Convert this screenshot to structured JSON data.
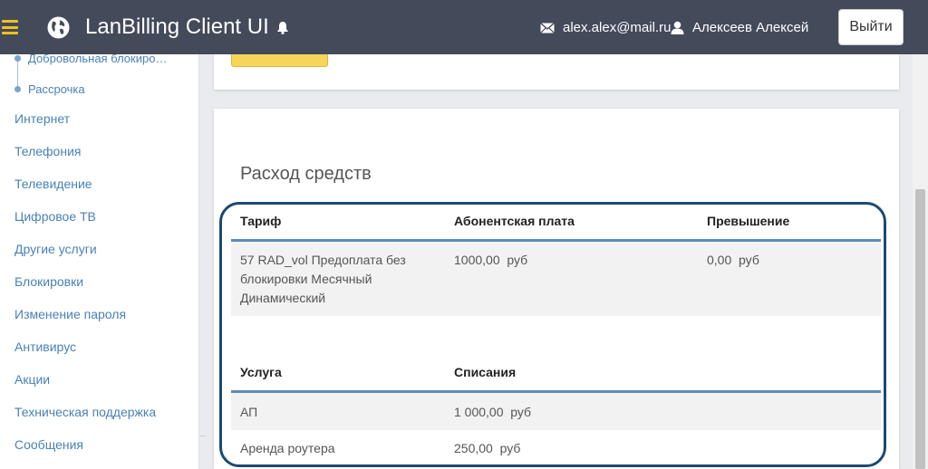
{
  "header": {
    "title": "LanBilling Client UI",
    "email": "alex.alex@mail.ru",
    "username": "Алексеев Алексей",
    "logout_label": "Выйти",
    "icons": [
      "menu-icon",
      "globe-icon",
      "bell-icon",
      "mail-icon",
      "user-icon"
    ]
  },
  "sidebar": {
    "sub_items": [
      "Добровольная блокиро…",
      "Рассрочка"
    ],
    "items": [
      "Интернет",
      "Телефония",
      "Телевидение",
      "Цифровое ТВ",
      "Другие услуги",
      "Блокировки",
      "Изменение пароля",
      "Антивирус",
      "Акции",
      "Техническая поддержка",
      "Сообщения"
    ]
  },
  "section": {
    "title": "Расход средств"
  },
  "tariff_table": {
    "headers": [
      "Тариф",
      "Абонентская плата",
      "Превышение"
    ],
    "rows": [
      {
        "tariff": "57 RAD_vol Предоплата без блокировки Месячный Динамический",
        "fee": "1000,00  руб",
        "excess": "0,00  руб"
      }
    ]
  },
  "service_table": {
    "headers": [
      "Услуга",
      "Списания"
    ],
    "rows": [
      {
        "service": "АП",
        "charge": "1 000,00  руб"
      },
      {
        "service": "Аренда роутера",
        "charge": "250,00  руб"
      }
    ]
  },
  "colors": {
    "header_bg": "#434a5a",
    "accent_yellow": "#f2c01e",
    "link_blue": "#4a81b8",
    "table_rule": "#5d8bb8",
    "highlight_ring": "#1b4a72"
  }
}
